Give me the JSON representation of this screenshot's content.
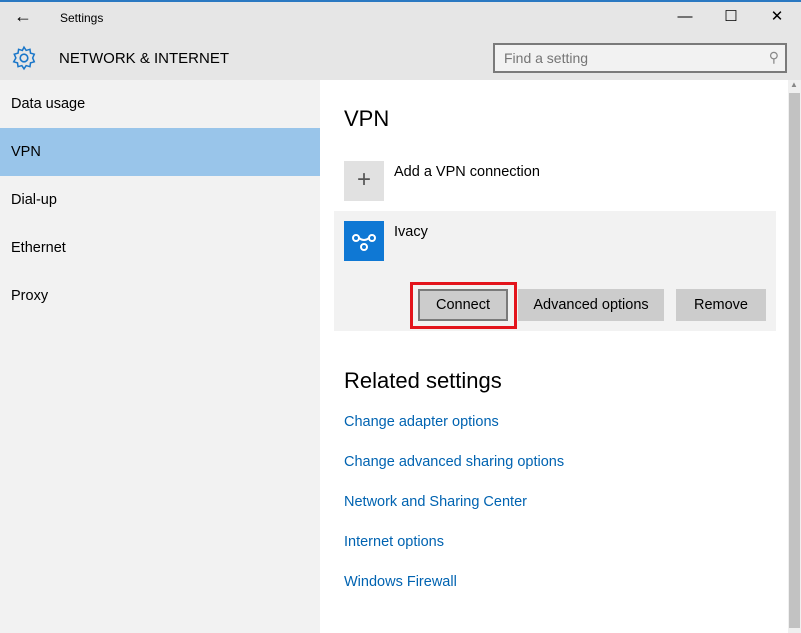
{
  "window": {
    "title": "Settings",
    "back_icon": "arrow-left-icon",
    "minimize": "—",
    "maximize": "☐",
    "close": "✕"
  },
  "header": {
    "section": "NETWORK & INTERNET",
    "search_placeholder": "Find a setting"
  },
  "sidebar": {
    "items": [
      {
        "label": "Data usage"
      },
      {
        "label": "VPN",
        "selected": true
      },
      {
        "label": "Dial-up"
      },
      {
        "label": "Ethernet"
      },
      {
        "label": "Proxy"
      }
    ]
  },
  "main": {
    "title": "VPN",
    "add_label": "Add a VPN connection",
    "connection": {
      "name": "Ivacy",
      "connect": "Connect",
      "advanced": "Advanced options",
      "remove": "Remove"
    },
    "related_title": "Related settings",
    "links": [
      "Change adapter options",
      "Change advanced sharing options",
      "Network and Sharing Center",
      "Internet options",
      "Windows Firewall"
    ]
  },
  "colors": {
    "accent": "#0063b1",
    "selected": "#99c5ea",
    "highlight": "#e3141c",
    "logo": "#0f78d4"
  }
}
